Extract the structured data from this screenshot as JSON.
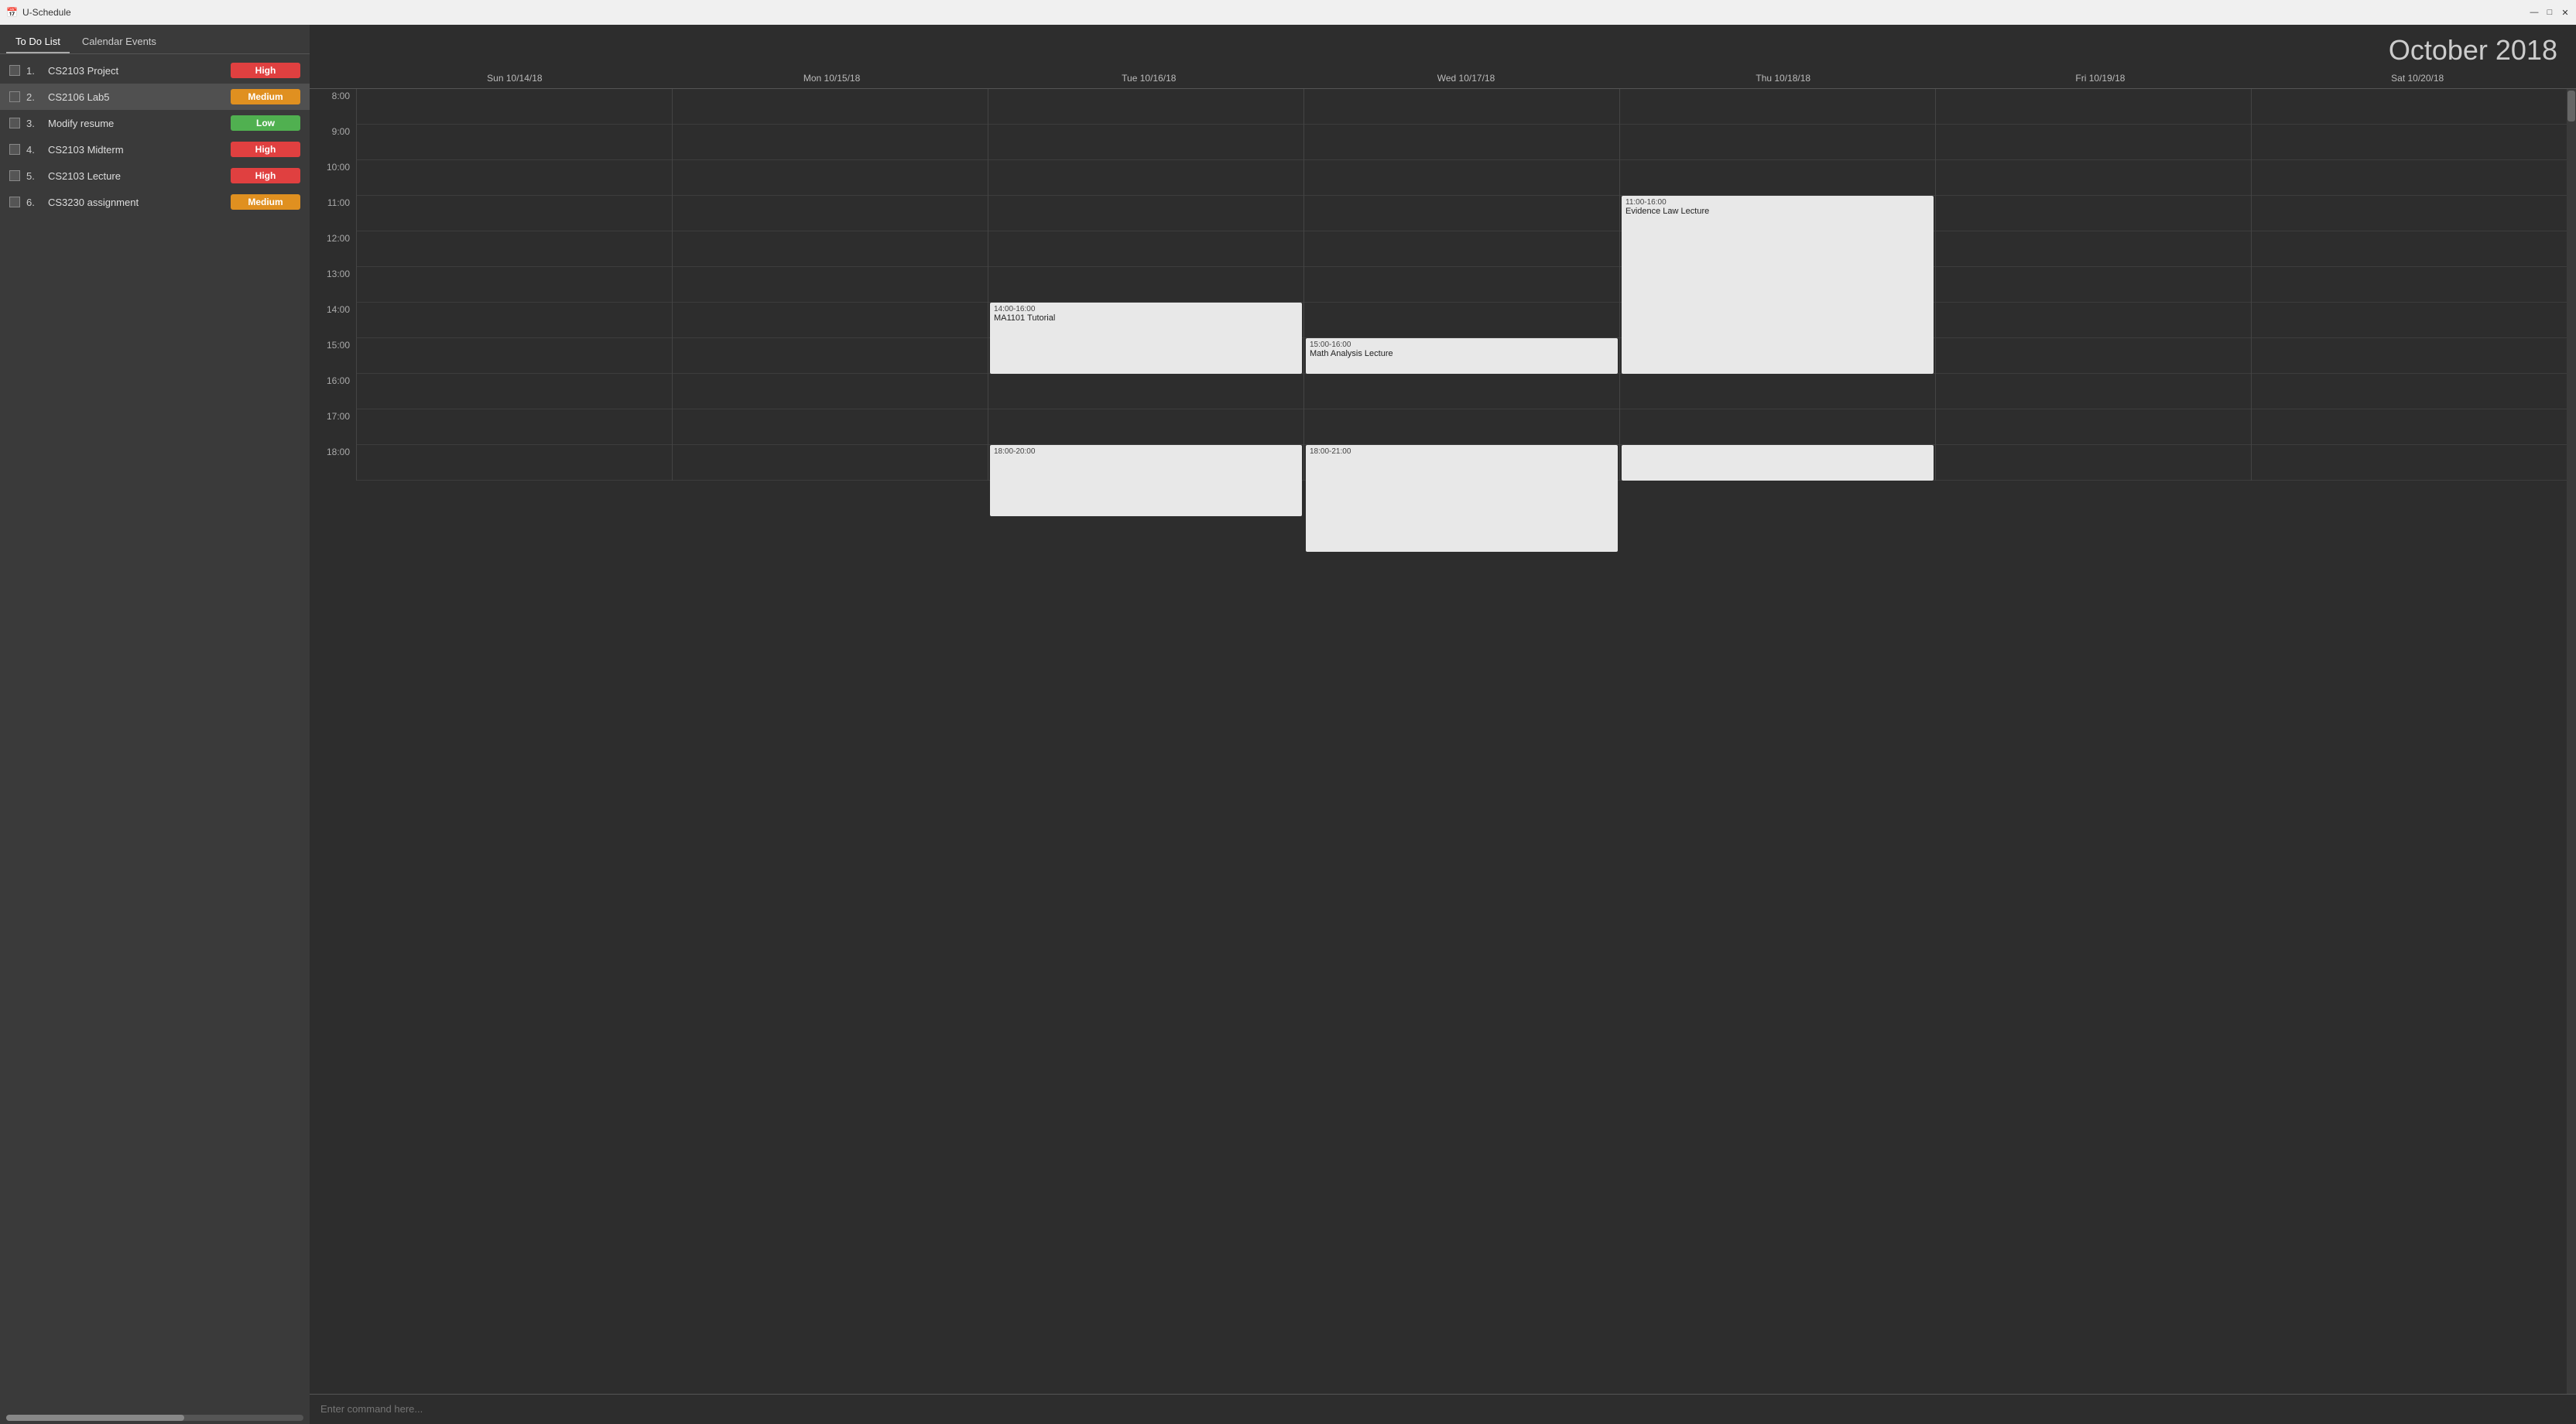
{
  "titleBar": {
    "title": "U-Schedule",
    "minimize": "—",
    "maximize": "□",
    "close": "✕"
  },
  "sidebar": {
    "tabs": [
      {
        "id": "todo",
        "label": "To Do List",
        "active": true
      },
      {
        "id": "calendar",
        "label": "Calendar Events",
        "active": false
      }
    ],
    "todoItems": [
      {
        "number": "1.",
        "name": "CS2103 Project",
        "priority": "High",
        "badgeClass": "badge-high"
      },
      {
        "number": "2.",
        "name": "CS2106 Lab5",
        "priority": "Medium",
        "badgeClass": "badge-medium"
      },
      {
        "number": "3.",
        "name": "Modify resume",
        "priority": "Low",
        "badgeClass": "badge-low"
      },
      {
        "number": "4.",
        "name": "CS2103 Midterm",
        "priority": "High",
        "badgeClass": "badge-high"
      },
      {
        "number": "5.",
        "name": "CS2103 Lecture",
        "priority": "High",
        "badgeClass": "badge-high"
      },
      {
        "number": "6.",
        "name": "CS3230 assignment",
        "priority": "Medium",
        "badgeClass": "badge-medium"
      }
    ]
  },
  "calendar": {
    "monthYear": "October 2018",
    "dayHeaders": [
      "Sun 10/14/18",
      "Mon 10/15/18",
      "Tue 10/16/18",
      "Wed 10/17/18",
      "Thu 10/18/18",
      "Fri 10/19/18",
      "Sat 10/20/18"
    ],
    "timeSlots": [
      "8:00",
      "9:00",
      "10:00",
      "11:00",
      "12:00",
      "13:00",
      "14:00",
      "15:00",
      "16:00",
      "17:00",
      "18:00"
    ],
    "events": [
      {
        "id": "evt1",
        "dayIndex": 2,
        "startHour": 14,
        "endHour": 16,
        "timeLabel": "14:00-16:00",
        "title": "MA1101 Tutorial"
      },
      {
        "id": "evt2",
        "dayIndex": 3,
        "startHour": 15,
        "endHour": 16,
        "timeLabel": "15:00-16:00",
        "title": "Math Analysis Lecture"
      },
      {
        "id": "evt3",
        "dayIndex": 4,
        "startHour": 11,
        "endHour": 16,
        "timeLabel": "11:00-16:00",
        "title": "Evidence Law Lecture"
      },
      {
        "id": "evt4",
        "dayIndex": 2,
        "startHour": 18,
        "endHour": 20,
        "timeLabel": "18:00-20:00",
        "title": ""
      },
      {
        "id": "evt5",
        "dayIndex": 3,
        "startHour": 18,
        "endHour": 21,
        "timeLabel": "18:00-21:00",
        "title": ""
      },
      {
        "id": "evt6",
        "dayIndex": 4,
        "startHour": 18,
        "endHour": 19,
        "timeLabel": "",
        "title": ""
      }
    ]
  },
  "commandBar": {
    "placeholder": "Enter command here..."
  }
}
